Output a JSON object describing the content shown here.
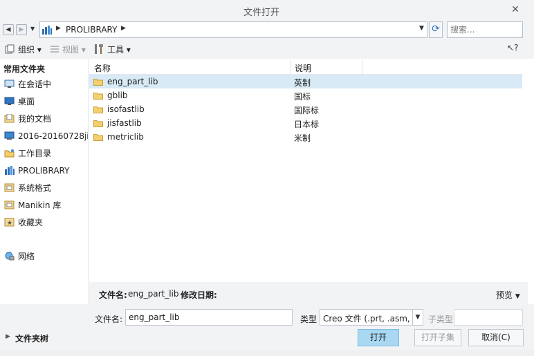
{
  "window": {
    "title": "文件打开"
  },
  "nav": {
    "path": "PROLIBRARY",
    "search_placeholder": "搜索..."
  },
  "toolbar": {
    "organize": "组织",
    "view": "视图",
    "tools": "工具",
    "help_label": "?"
  },
  "sidebar": {
    "heading": "常用文件夹",
    "items": [
      {
        "label": "在会话中",
        "icon": "monitor-icon"
      },
      {
        "label": "桌面",
        "icon": "desktop-icon"
      },
      {
        "label": "我的文档",
        "icon": "documents-icon"
      },
      {
        "label": "2016-20160728ji",
        "icon": "computer-icon"
      },
      {
        "label": "工作目录",
        "icon": "workdir-folder-icon"
      },
      {
        "label": "PROLIBRARY",
        "icon": "library-icon"
      },
      {
        "label": "系统格式",
        "icon": "system-format-icon"
      },
      {
        "label": "Manikin 库",
        "icon": "manikin-icon"
      },
      {
        "label": "收藏夹",
        "icon": "favorites-icon"
      }
    ],
    "network": {
      "label": "网络",
      "icon": "network-icon"
    }
  },
  "file_list": {
    "columns": [
      "名称",
      "说明"
    ],
    "rows": [
      {
        "name": "eng_part_lib",
        "desc": "英制",
        "selected": true
      },
      {
        "name": "gblib",
        "desc": "国标",
        "selected": false
      },
      {
        "name": "isofastlib",
        "desc": "国际标",
        "selected": false
      },
      {
        "name": "jisfastlib",
        "desc": "日本标",
        "selected": false
      },
      {
        "name": "metriclib",
        "desc": "米制",
        "selected": false
      }
    ]
  },
  "info": {
    "filename_label": "文件名:",
    "filename_value": "eng_part_lib",
    "modified_label": "修改日期:",
    "preview": "预览"
  },
  "form": {
    "filename_label": "文件名:",
    "filename_value": "eng_part_lib",
    "type_label": "类型",
    "type_value": "Creo 文件 (.prt, .asm,",
    "subtype_label": "子类型"
  },
  "footer": {
    "folder_tree": "文件夹树",
    "open": "打开",
    "open_representation": "打开子集",
    "cancel": "取消(C)"
  },
  "colors": {
    "selected_row": "#d7eaf5",
    "primary_button": "#a8d8f2",
    "chrome": "#f2f3f5"
  }
}
